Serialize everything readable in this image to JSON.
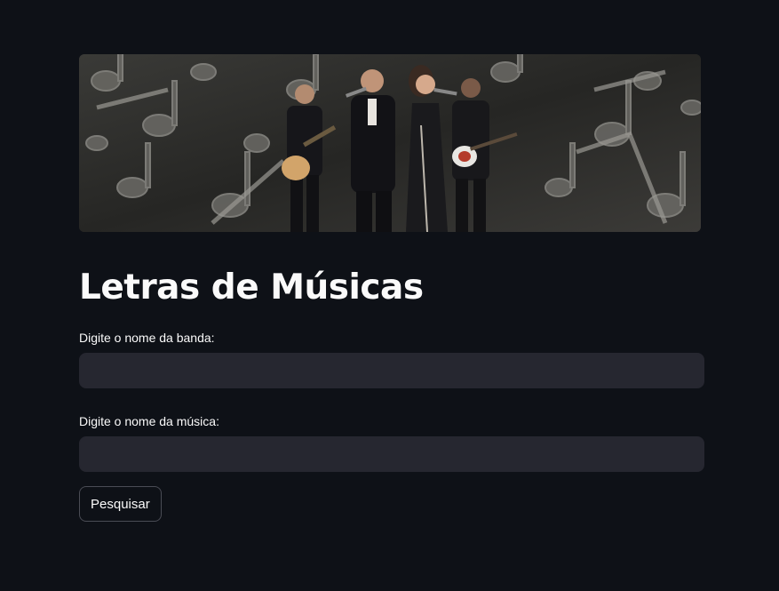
{
  "banner": {
    "description_icon": "band-performing-photo"
  },
  "page": {
    "title": "Letras de Músicas"
  },
  "form": {
    "band_label": "Digite o nome da banda:",
    "band_value": "",
    "song_label": "Digite o nome da música:",
    "song_value": "",
    "search_button": "Pesquisar"
  },
  "colors": {
    "background": "#0e1117",
    "input_bg": "#262730",
    "text": "#fafafa",
    "button_border": "#4a4c55"
  }
}
